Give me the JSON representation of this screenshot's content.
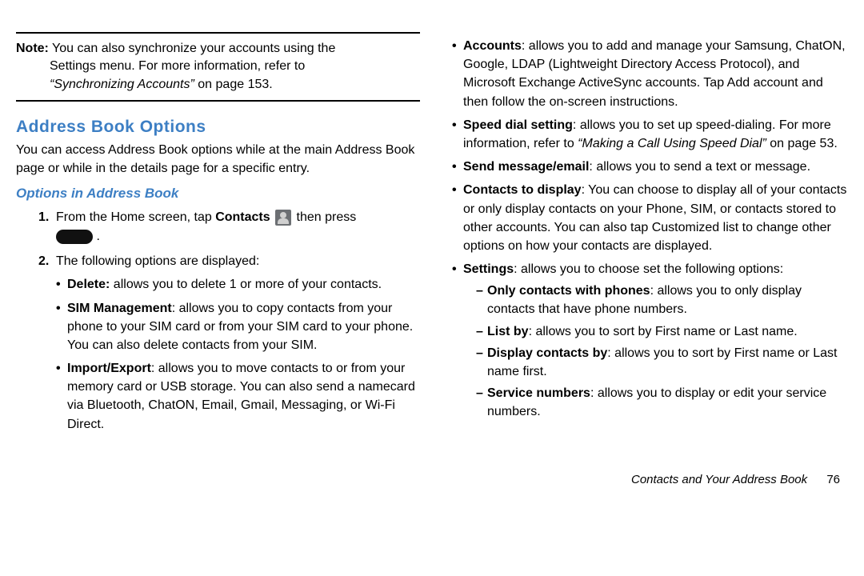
{
  "note": {
    "label": "Note:",
    "line1": "You can also synchronize your accounts using the",
    "line2": "Settings menu. For more information, refer to",
    "line3a": "“Synchronizing Accounts”",
    "line3b": "on page 153."
  },
  "heading1": "Address Book Options",
  "intro": "You can access Address Book options while at the main Address Book page or while in the details page for a specific entry.",
  "heading2": "Options in Address Book",
  "step1": {
    "num": "1.",
    "pre": "From the Home screen, tap ",
    "contacts": "Contacts",
    "post": " then press",
    "period": "."
  },
  "step2": {
    "num": "2.",
    "text": "The following options are displayed:"
  },
  "leftBullets": [
    {
      "bold": "Delete:",
      "text": " allows you to delete 1 or more of your contacts."
    },
    {
      "bold": "SIM Management",
      "text": ": allows you to copy contacts from your phone to your SIM card or from your SIM card to your phone. You can also delete contacts from your SIM."
    },
    {
      "bold": "Import/Export",
      "text": ": allows you to move contacts to or from your memory card or USB storage. You can also send a namecard via Bluetooth, ChatON, Email, Gmail, Messaging, or Wi-Fi Direct."
    }
  ],
  "rightBullets": [
    {
      "bold": "Accounts",
      "text": ": allows you to add and manage your Samsung, ChatON, Google, LDAP (Lightweight Directory Access Protocol), and Microsoft Exchange ActiveSync accounts. Tap Add account and then follow the on-screen instructions."
    },
    {
      "bold": "Speed dial setting",
      "text": ": allows you to set up speed-dialing.  For more information, refer to ",
      "ref": "“Making a Call Using Speed Dial”",
      "tail": " on page 53."
    },
    {
      "bold": "Send message/email",
      "text": ": allows you to send a text or message."
    },
    {
      "bold": "Contacts to display",
      "text": ": You can choose to display all of your contacts or only display contacts on your Phone, SIM, or contacts stored to other accounts. You can also tap Customized list to change other options on how your contacts are displayed."
    },
    {
      "bold": "Settings",
      "text": ": allows you to choose set the following options:"
    }
  ],
  "subBullets": [
    {
      "bold": "Only contacts with phones",
      "text": ": allows you to only display contacts that have phone numbers."
    },
    {
      "bold": "List by",
      "text": ": allows you to sort by First name or Last name."
    },
    {
      "bold": "Display contacts by",
      "text": ": allows you to sort by First name or Last name first."
    },
    {
      "bold": "Service numbers",
      "text": ": allows you to display or edit your service numbers."
    }
  ],
  "footer": {
    "section": "Contacts and Your Address Book",
    "page": "76"
  }
}
